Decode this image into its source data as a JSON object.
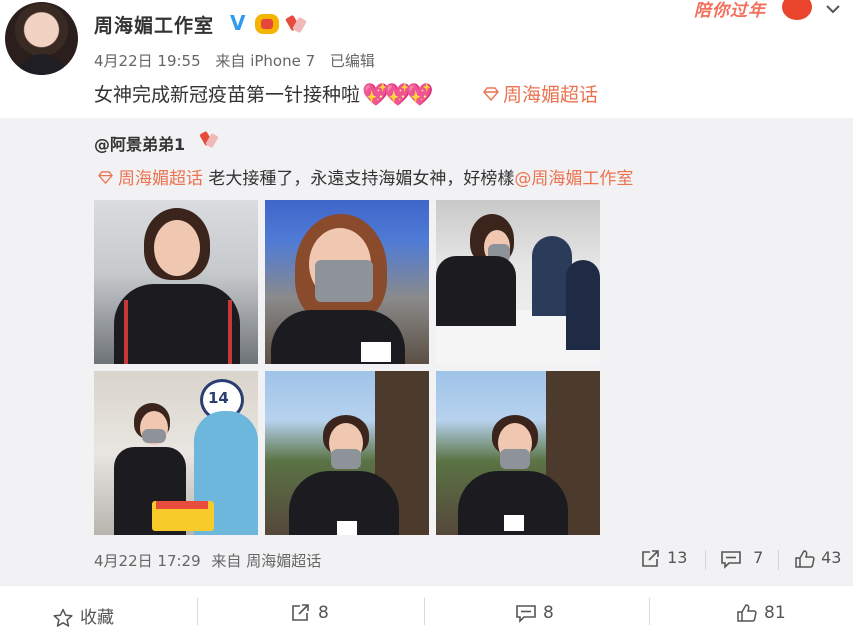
{
  "post": {
    "author": "周海媚工作室",
    "date": "4月22日 19:55",
    "source": "来自 iPhone 7",
    "edited": "已编辑",
    "text": "女神完成新冠疫苗第一针接种啦",
    "hearts": [
      "💖",
      "💖",
      "💖"
    ],
    "topic": "周海媚超话",
    "banner": "陪你过年"
  },
  "repost": {
    "author": "@阿景弟弟1",
    "topic": "周海媚超话",
    "text": " 老大接種了，永遠支持海媚女神，好榜樣",
    "mention": "@周海媚工作室",
    "date": "4月22日 17:29",
    "source": "来自 周海媚超话",
    "forward_count": "13",
    "comment_count": "7",
    "like_count": "43"
  },
  "footer": {
    "favorite_label": "收藏",
    "forward_count": "8",
    "comment_count": "8",
    "like_count": "81"
  },
  "colors": {
    "link": "#eb7350",
    "verified": "#2e9bf0",
    "repost_bg": "#f2f2f5"
  },
  "icons": [
    "verified-icon",
    "vip-badge-icon",
    "fan-badge-icon",
    "chevron-down-icon",
    "topic-gem-icon",
    "forward-icon",
    "comment-icon",
    "like-icon",
    "star-icon"
  ]
}
